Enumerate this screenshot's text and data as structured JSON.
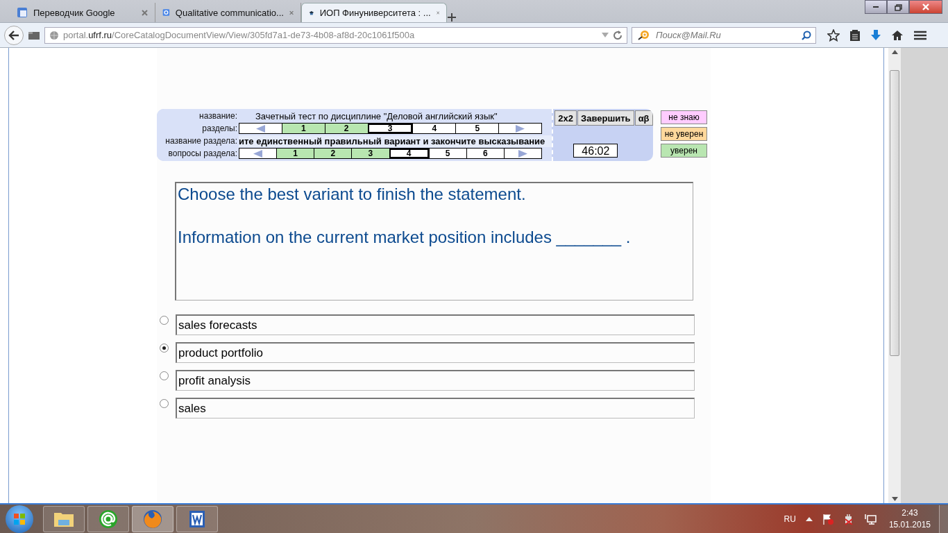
{
  "browser": {
    "tabs": [
      {
        "title": "Переводчик Google",
        "selected": false
      },
      {
        "title": "Qualitative communicatio...",
        "selected": false
      },
      {
        "title": "ИОП Финуниверситета : ...",
        "selected": true
      }
    ],
    "address": {
      "subdomain": "portal.",
      "domain": "ufrf.ru",
      "path": "/CoreCatalogDocumentView/View/305fd7a1-de73-4b08-af8d-20c1061f500a"
    },
    "search": {
      "placeholder": "Поиск@Mail.Ru"
    }
  },
  "test_header": {
    "title_label": "название:",
    "title": "Зачетный тест по дисциплине \"Деловой английский язык\"",
    "sections_label": "разделы:",
    "sections": [
      {
        "label": "1",
        "answered": true,
        "current": false
      },
      {
        "label": "2",
        "answered": true,
        "current": false
      },
      {
        "label": "3",
        "answered": false,
        "current": true
      },
      {
        "label": "4",
        "answered": false,
        "current": false
      },
      {
        "label": "5",
        "answered": false,
        "current": false
      }
    ],
    "section_name_label": "название раздела:",
    "section_name": "ите единственный правильный вариант и закончите высказывание",
    "questions_label": "вопросы раздела:",
    "questions": [
      {
        "label": "1",
        "answered": true,
        "current": false
      },
      {
        "label": "2",
        "answered": true,
        "current": false
      },
      {
        "label": "3",
        "answered": true,
        "current": false
      },
      {
        "label": "4",
        "answered": false,
        "current": true
      },
      {
        "label": "5",
        "answered": false,
        "current": false
      },
      {
        "label": "6",
        "answered": false,
        "current": false
      }
    ],
    "buttons": [
      "2x2",
      "Завершить",
      "αβ"
    ],
    "timer": "46:02"
  },
  "confidence": [
    {
      "label": "не знаю",
      "color": "#ffccff"
    },
    {
      "label": "не уверен",
      "color": "#ffd89c"
    },
    {
      "label": "уверен",
      "color": "#b9e6b1"
    }
  ],
  "question": {
    "lines": [
      "Choose the best variant to finish the statement.",
      "Information on the current market position includes _______ ."
    ]
  },
  "options": [
    {
      "text": "sales forecasts",
      "selected": false
    },
    {
      "text": "product portfolio",
      "selected": true
    },
    {
      "text": "profit analysis",
      "selected": false
    },
    {
      "text": "sales",
      "selected": false
    }
  ],
  "taskbar": {
    "apps": [
      {
        "kind": "folder",
        "selected": false
      },
      {
        "kind": "mail",
        "selected": false
      },
      {
        "kind": "browser",
        "selected": true
      },
      {
        "kind": "word",
        "selected": false
      }
    ],
    "language": "RU",
    "time": "2:43",
    "date": "15.01.2015"
  }
}
